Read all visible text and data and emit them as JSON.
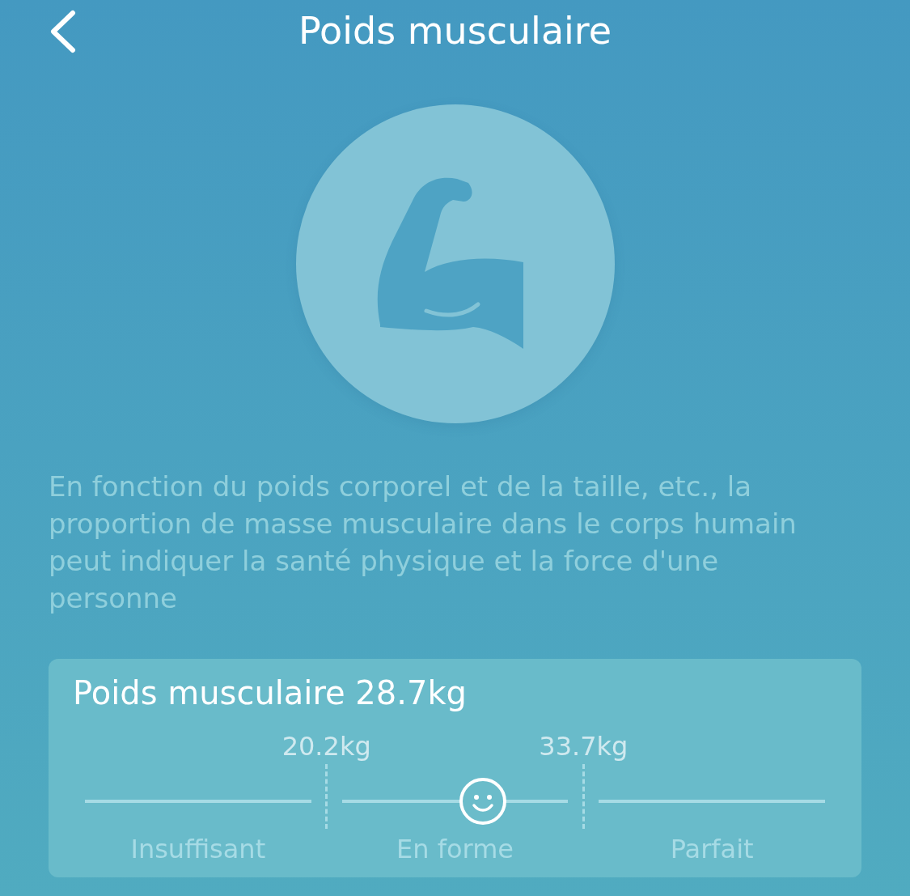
{
  "header": {
    "title": "Poids musculaire"
  },
  "description": "En fonction du poids corporel et de la taille, etc., la proportion de masse musculaire dans le corps humain peut indiquer la santé physique et la force d'une personne",
  "card": {
    "title": "Poids musculaire 28.7kg",
    "thresholds": [
      "20.2kg",
      "33.7kg"
    ],
    "zones": [
      {
        "label": "Insuffisant"
      },
      {
        "label": "En forme"
      },
      {
        "label": "Parfait"
      }
    ],
    "level": 0.538
  }
}
